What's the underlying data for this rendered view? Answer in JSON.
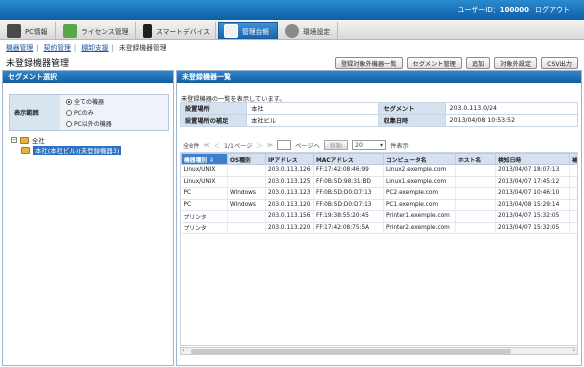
{
  "header": {
    "user_label": "ユーザーID：",
    "user_id": "100000",
    "logout": "ログアウト"
  },
  "tabs": [
    {
      "label": "PC情報",
      "icon": "pc-icon"
    },
    {
      "label": "ライセンス管理",
      "icon": "license-icon"
    },
    {
      "label": "スマートデバイス",
      "icon": "smart-device-icon"
    },
    {
      "label": "管理台帳",
      "icon": "ledger-icon",
      "active": true
    },
    {
      "label": "環境設定",
      "icon": "settings-icon"
    }
  ],
  "breadcrumb": [
    "機器管理",
    "契約管理",
    "棚卸支援",
    "未登録機器管理"
  ],
  "page_title": "未登録機器管理",
  "actions": [
    "登録対象外機器一覧",
    "セグメント管理",
    "追加",
    "対象外設定",
    "CSV出力"
  ],
  "left_panel": {
    "title": "セグメント選択",
    "filter_label": "表示範囲",
    "options": [
      "全ての機器",
      "PCのみ",
      "PC以外の機器"
    ],
    "selected": 0,
    "tree_root": "全社",
    "tree_child": "本社(本社ビル)(未登録機器3)"
  },
  "right_panel": {
    "title": "未登録機器一覧",
    "notice": "未登録機器の一覧を表示しています。",
    "info": {
      "place_label": "設置場所",
      "place_value": "本社",
      "segment_label": "セグメント",
      "segment_value": "203.0.113.0/24",
      "supplement_label": "設置場所の補足",
      "supplement_value": "本社ビル",
      "collected_label": "収集日時",
      "collected_value": "2013/04/08 10:53:52"
    },
    "pager": {
      "total": "全8件",
      "prev_first": "≪",
      "prev": "＜",
      "page_info": "1/1ページ",
      "next": "＞",
      "next_last": "≫",
      "page_to": "ページへ",
      "move": "移動",
      "per_page": "20",
      "per_page_suffix": "件表示"
    },
    "columns": [
      "機器種別",
      "OS種別",
      "IPアドレス",
      "MACアドレス",
      "コンピュータ名",
      "ホスト名",
      "検知日時",
      "補足"
    ],
    "rows": [
      [
        "Linux/UNIX",
        "",
        "203.0.113.126",
        "FF:17:42:08:46:99",
        "Linux2.exemple.com",
        "",
        "2013/04/07 18:07:13",
        ""
      ],
      [
        "Linux/UNIX",
        "",
        "203.0.113.125",
        "FF:0B:5D:98:31:BD",
        "Linux1.exemple.com",
        "",
        "2013/04/07 17:45:12",
        ""
      ],
      [
        "PC",
        "Windows",
        "203.0.113.123",
        "FF:0B:5D:D0:D7:13",
        "PC2.exemple.com",
        "",
        "2013/04/07 10:46:10",
        ""
      ],
      [
        "PC",
        "Windows",
        "203.0.113.120",
        "FF:0B:5D:D0:D7:13",
        "PC1.exemple.com",
        "",
        "2013/04/08 15:29:14",
        ""
      ],
      [
        "プリンタ",
        "",
        "203.0.113.156",
        "FF:19:38:55:20:45",
        "Printer1.exemple.com",
        "",
        "2013/04/07 15:32:05",
        ""
      ],
      [
        "プリンタ",
        "",
        "203.0.113.220",
        "FF:17:42:08:75:5A",
        "Printer2.exemple.com",
        "",
        "2013/04/07 15:32:05",
        ""
      ]
    ]
  }
}
